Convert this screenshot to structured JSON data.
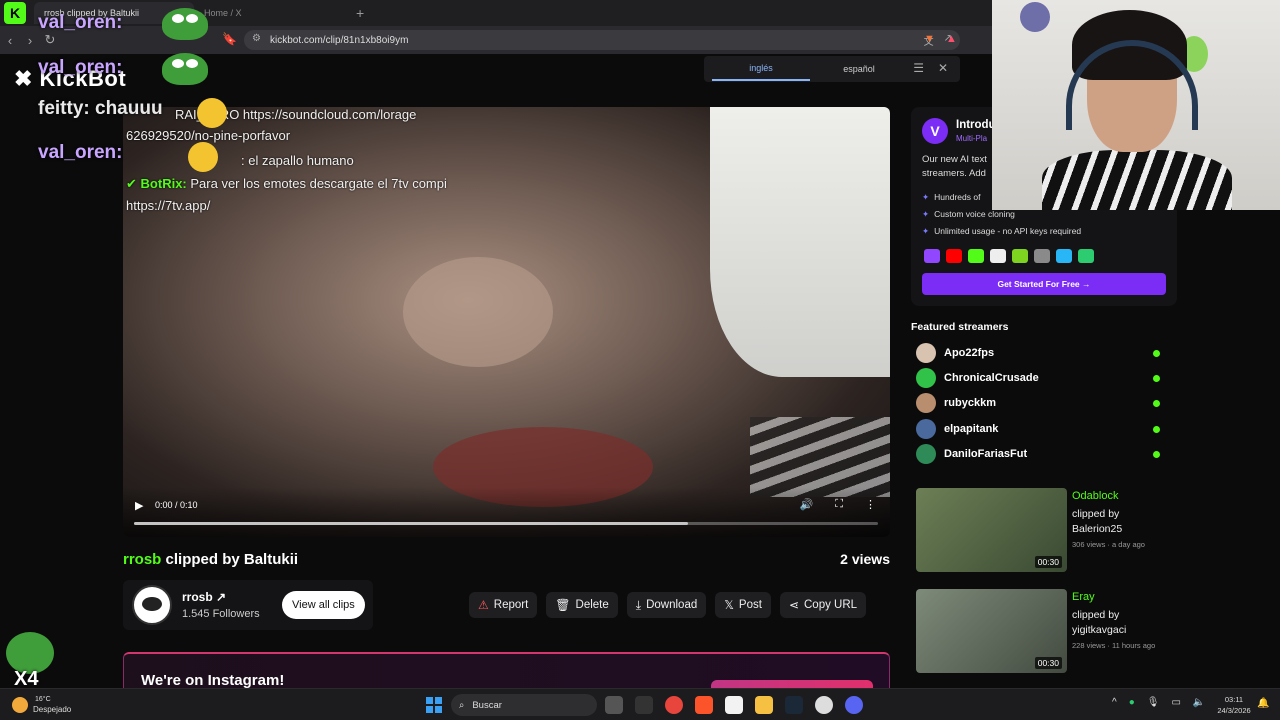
{
  "browser": {
    "tabs": [
      {
        "label": "rrosb clipped by Baltukii",
        "active": true
      },
      {
        "label": "Home / X",
        "active": false
      }
    ],
    "url": "kickbot.com/clip/81n1xb8oi9ym"
  },
  "translate": {
    "from": "inglés",
    "to": "español"
  },
  "logo": "KickBot",
  "stream_chat": [
    {
      "name": "val_oren:"
    },
    {
      "name": "val_oren:"
    },
    {
      "name": "feitty: chauuu"
    },
    {
      "name": "val_oren:"
    }
  ],
  "video": {
    "chat_lines": [
      "RAI__BRO https://soundcloud.com/lorage",
      "626929520/no-pine-porfavor",
      ": el zapallo humano",
      "Para ver los emotes descargate el 7tv compi",
      "https://7tv.app/"
    ],
    "bot_name": "BotRix:",
    "time": "0:00 / 0:10",
    "progress": 0.745
  },
  "clip": {
    "streamer": "rrosb",
    "clipped_by": "clipped by Baltukii",
    "views": "2 views"
  },
  "channel": {
    "name": "rrosb",
    "followers": "1.545 Followers",
    "view_all": "View all clips"
  },
  "actions": [
    {
      "label": "Report",
      "icon": "warning-icon"
    },
    {
      "label": "Delete",
      "icon": "trash-icon"
    },
    {
      "label": "Download",
      "icon": "download-icon"
    },
    {
      "label": "Post",
      "icon": "x-logo-icon"
    },
    {
      "label": "Copy URL",
      "icon": "share-icon"
    }
  ],
  "instagram": {
    "title": "We're on Instagram!"
  },
  "promo": {
    "title": "Introdu",
    "subtitle": "Multi-Pla",
    "desc": "Our new AI text streamers. Add",
    "features": [
      "Hundreds of",
      "Custom voice cloning",
      "Unlimited usage - no API keys required"
    ],
    "cta": "Get Started For Free →"
  },
  "featured": {
    "heading": "Featured streamers",
    "streamers": [
      "Apo22fps",
      "ChronicalCrusade",
      "rubyckkm",
      "elpapitank",
      "DaniloFariasFut"
    ]
  },
  "recommended": [
    {
      "streamer": "Odablock",
      "by": "clipped by Balerion25",
      "meta": "306 views · a day ago",
      "duration": "00:30"
    },
    {
      "streamer": "Eray",
      "by": "clipped by yigitkavgaci",
      "meta": "228 views · 11 hours ago",
      "duration": "00:30"
    }
  ],
  "overlay": {
    "multiplier": "X4"
  },
  "taskbar": {
    "temp": "16°C",
    "weather": "Despejado",
    "search": "Buscar",
    "time": "03:11",
    "date": "24/3/2026"
  },
  "colors": {
    "kick_green": "#53fc18",
    "accent_purple": "#7b2cf5",
    "bg": "#0b0b0c"
  }
}
